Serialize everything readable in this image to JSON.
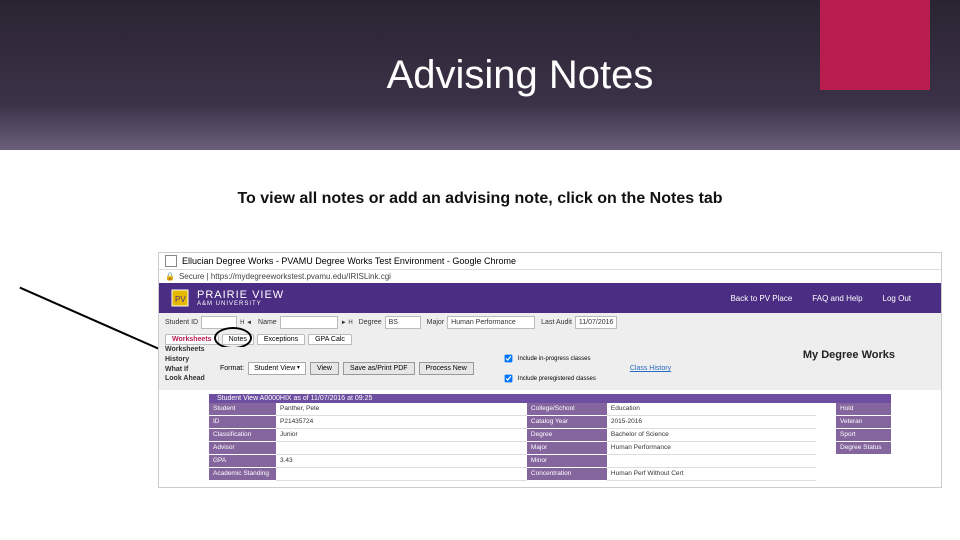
{
  "slide": {
    "title": "Advising Notes",
    "instruction": "To view all notes or add an advising note, click on the Notes tab"
  },
  "browser": {
    "tab_title": "Ellucian Degree Works - PVAMU Degree Works Test Environment - Google Chrome",
    "secure_label": "Secure",
    "url": "https://mydegreeworkstest.pvamu.edu/IRISLink.cgi"
  },
  "university": {
    "name": "PRAIRIE VIEW",
    "sub": "A&M UNIVERSITY",
    "links": {
      "back": "Back to PV Place",
      "faq": "FAQ and Help",
      "logout": "Log Out"
    }
  },
  "student_bar": {
    "sid_label": "Student ID",
    "nav_prev": "H ◄",
    "name_label": "Name",
    "nav_next": "► H",
    "degree_label": "Degree",
    "degree_value": "BS",
    "major_label": "Major",
    "major_value": "Human Performance",
    "last_audit_label": "Last Audit",
    "last_audit_value": "11/07/2016"
  },
  "tabs": {
    "worksheets": "Worksheets",
    "notes": "Notes",
    "exceptions": "Exceptions",
    "gpa_calc": "GPA Calc"
  },
  "side_nav": {
    "worksheets": "Worksheets",
    "history": "History",
    "whatif": "What If",
    "lookahead": "Look Ahead"
  },
  "actions": {
    "format_label": "Format:",
    "format_value": "Student View",
    "view": "View",
    "save_pdf": "Save as/Print PDF",
    "process_new": "Process New",
    "include_inprogress": "Include in-progress classes",
    "include_prereg": "Include preregistered classes",
    "class_history": "Class History",
    "my_degree_works": "My Degree Works"
  },
  "student_view_header": "Student View   A0000HIX as of 11/07/2016 at 09:25",
  "left_labels": {
    "student": "Student",
    "id": "ID",
    "classification": "Classification",
    "advisor": "Advisor",
    "gpa": "GPA",
    "academic_standing": "Academic Standing"
  },
  "left_values": {
    "student": "Panther, Pete",
    "id": "P21435724",
    "classification": "Junior",
    "advisor": "",
    "gpa": "3.43",
    "academic_standing": ""
  },
  "right_labels": {
    "college": "College/School",
    "catalog_year": "Catalog Year",
    "degree": "Degree",
    "major": "Major",
    "minor": "Minor",
    "concentration": "Concentration"
  },
  "right_values": {
    "college": "Education",
    "catalog_year": "2015-2016",
    "degree": "Bachelor of Science",
    "major": "Human Performance",
    "minor": "",
    "concentration": "Human Perf Without Cert"
  },
  "status_labels": {
    "hold": "Hold",
    "veteran": "Veteran",
    "sport": "Sport",
    "degree_status": "Degree Status"
  }
}
